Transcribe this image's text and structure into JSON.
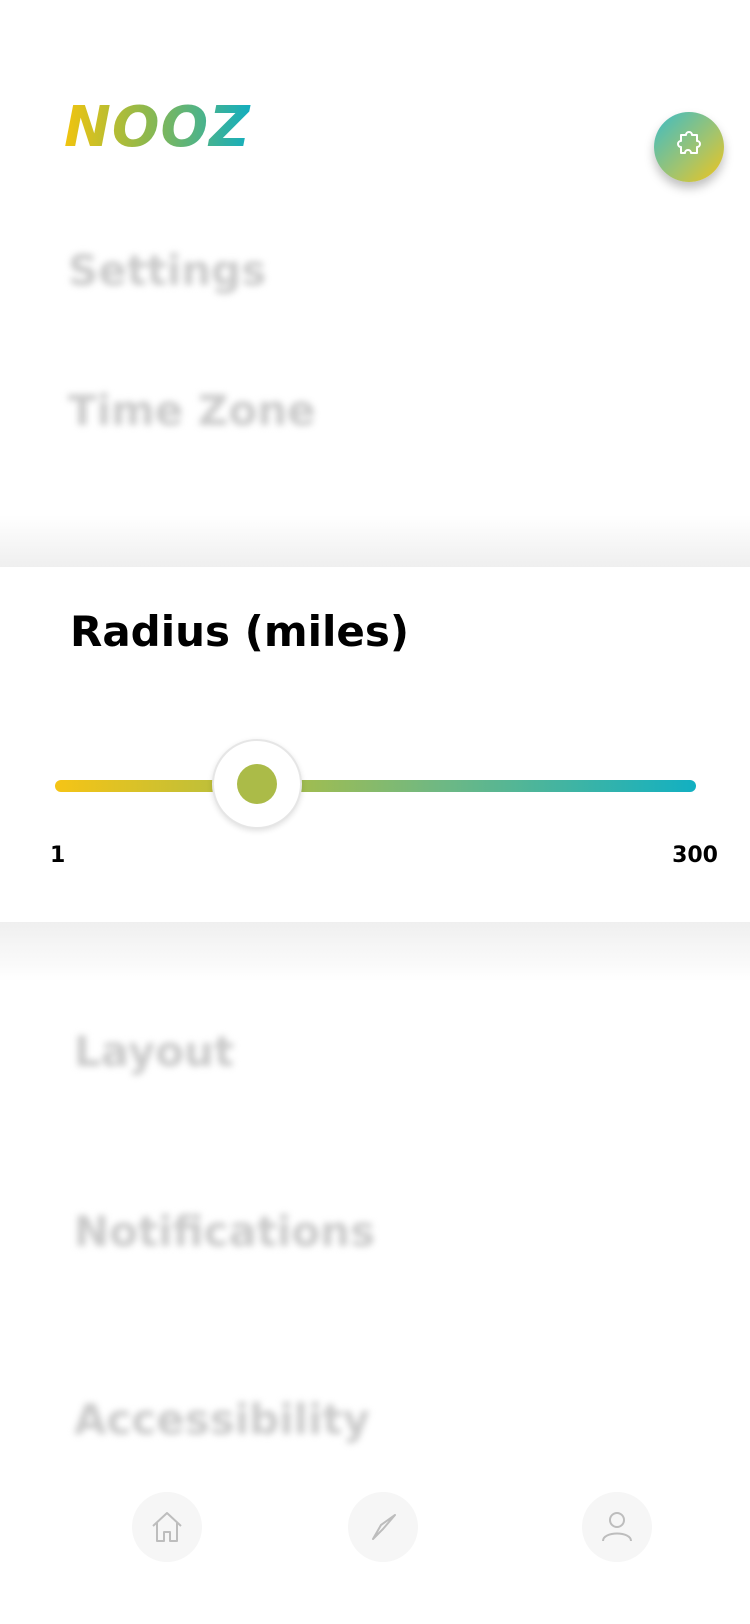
{
  "app": {
    "logo_text": "NOOZ"
  },
  "header": {
    "settings_icon": "puzzle-icon"
  },
  "menu": {
    "settings": "Settings",
    "time_zone": "Time Zone",
    "layout": "Layout",
    "notifications": "Notifications",
    "accessibility": "Accessibility"
  },
  "radius": {
    "title": "Radius (miles)",
    "min_label": "1",
    "max_label": "300",
    "min": 1,
    "max": 300,
    "value": 95
  },
  "bottom_nav": {
    "items": [
      {
        "icon": "home-icon"
      },
      {
        "icon": "compass-icon"
      },
      {
        "icon": "profile-icon"
      }
    ]
  },
  "colors": {
    "gradient_start": "#f5c416",
    "gradient_mid": "#a8bd48",
    "gradient_end": "#12b0c2",
    "thumb_dot": "#abbb48"
  }
}
